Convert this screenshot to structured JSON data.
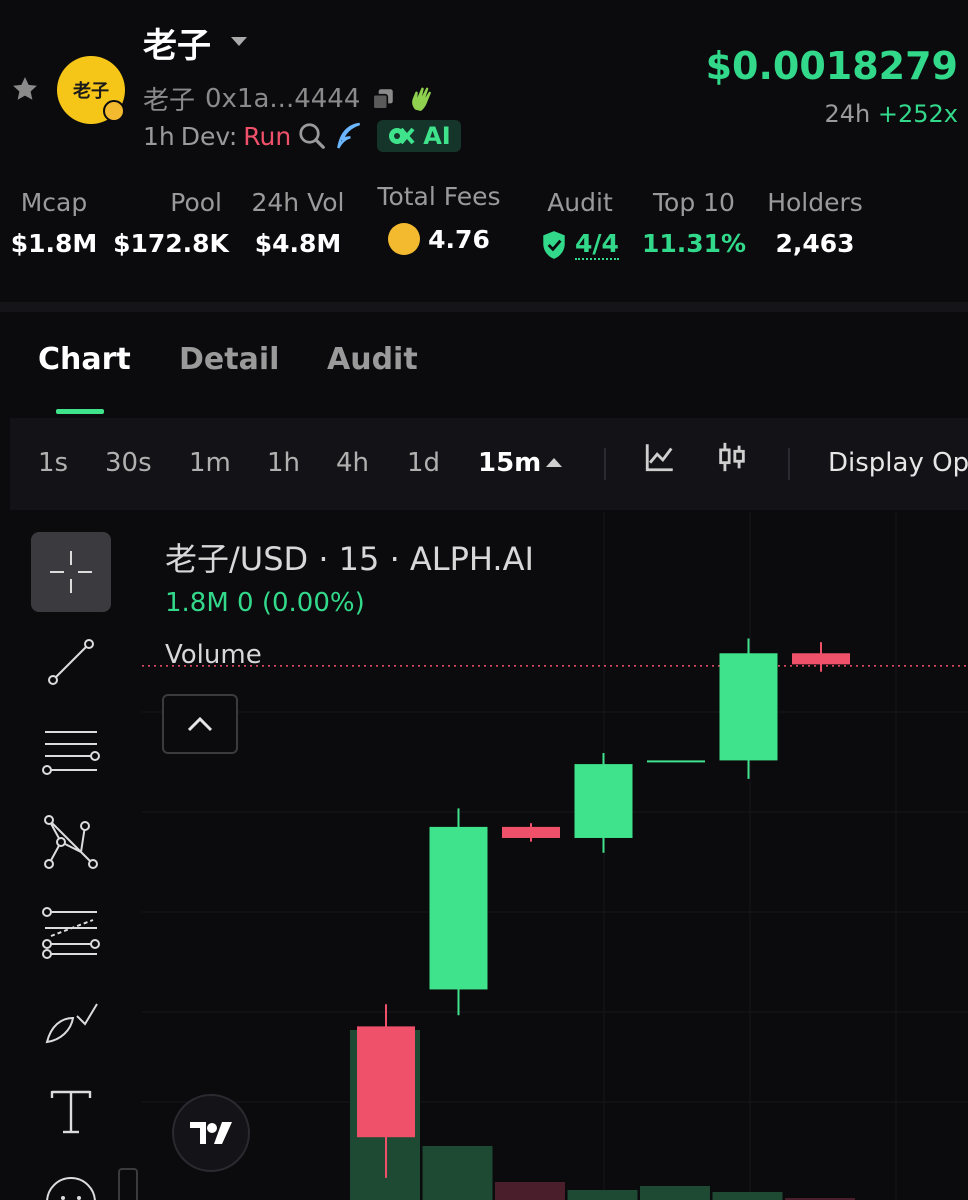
{
  "token": {
    "name": "老子",
    "avatar_text": "老子",
    "ticker": "老子",
    "address": "0x1a...4444",
    "age": "1h",
    "dev_label": "Dev:",
    "dev_status": "Run",
    "ai_label": "AI"
  },
  "price": {
    "value": "$0.0018279",
    "period": "24h",
    "change": "+252x"
  },
  "stats": [
    {
      "label": "Mcap",
      "value": "$1.8M"
    },
    {
      "label": "Pool",
      "value": "$172.8K"
    },
    {
      "label": "24h Vol",
      "value": "$4.8M"
    },
    {
      "label": "Total Fees",
      "value": "4.76"
    },
    {
      "label": "Audit",
      "value": "4/4"
    },
    {
      "label": "Top 10",
      "value": "11.31%"
    },
    {
      "label": "Holders",
      "value": "2,463"
    }
  ],
  "tabs": [
    {
      "label": "Chart",
      "active": true
    },
    {
      "label": "Detail",
      "active": false
    },
    {
      "label": "Audit",
      "active": false
    }
  ],
  "intervals": [
    "1s",
    "30s",
    "1m",
    "1h",
    "4h",
    "1d",
    "15m"
  ],
  "selected_interval": "15m",
  "display_options_label": "Display Opt",
  "chart_legend": {
    "title": "老子/USD · 15 · ALPH.AI",
    "values": "1.8M  0 (0.00%)",
    "volume_label": "Volume"
  },
  "colors": {
    "up": "#3fe38c",
    "down": "#f0516a",
    "accent": "#33d98b",
    "background": "#0b0b0e"
  },
  "icons": {
    "favorite": "star-icon",
    "copy": "copy-icon",
    "wave": "hand-wave-icon",
    "search": "search-icon",
    "feather": "feather-icon",
    "fees": "bnb-icon",
    "audit": "shield-check-icon"
  },
  "chart_data": {
    "type": "candlestick",
    "candles": [
      {
        "open": 0.000545,
        "high": 0.000575,
        "low": 0.00034,
        "close": 0.000395
      },
      {
        "open": 0.000595,
        "high": 0.00084,
        "low": 0.00056,
        "close": 0.000815
      },
      {
        "open": 0.000815,
        "high": 0.00082,
        "low": 0.000795,
        "close": 0.0008
      },
      {
        "open": 0.0008,
        "high": 0.000915,
        "low": 0.00078,
        "close": 0.0009
      },
      {
        "open": 0.000905,
        "high": 0.000905,
        "low": 0.000905,
        "close": 0.000905
      },
      {
        "open": 0.000905,
        "high": 0.00107,
        "low": 0.00088,
        "close": 0.00105
      },
      {
        "open": 0.00105,
        "high": 0.001065,
        "low": 0.001025,
        "close": 0.001035
      }
    ],
    "volumes": [
      {
        "value": 0.85,
        "direction": "up"
      },
      {
        "value": 0.27,
        "direction": "up"
      },
      {
        "value": 0.09,
        "direction": "down"
      },
      {
        "value": 0.05,
        "direction": "up"
      },
      {
        "value": 0.07,
        "direction": "up"
      },
      {
        "value": 0.04,
        "direction": "up"
      },
      {
        "value": 0.01,
        "direction": "down"
      }
    ],
    "last_price_line": 0.001033,
    "ylim": [
      0.00031,
      0.00116
    ]
  }
}
